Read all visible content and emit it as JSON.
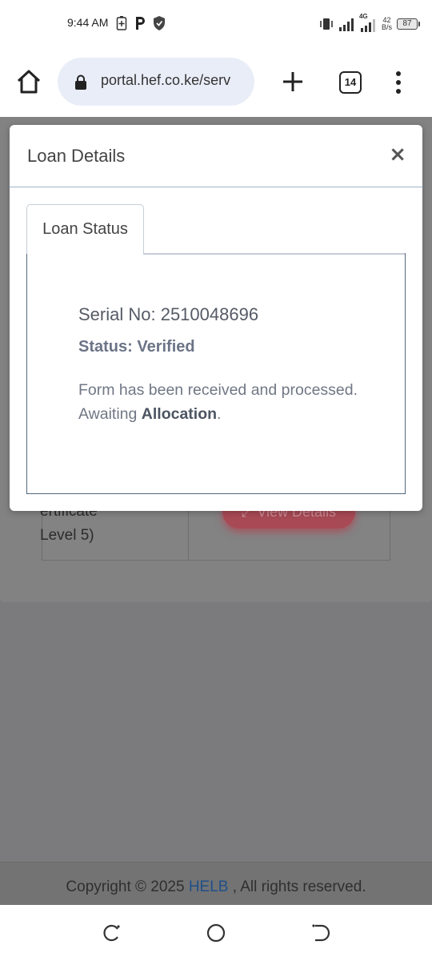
{
  "status_bar": {
    "time": "9:44 AM",
    "network_type": "4G",
    "net_speed_value": "42",
    "net_speed_unit": "B/s",
    "battery": "87"
  },
  "browser": {
    "url": "portal.hef.co.ke/serv",
    "tab_count": "14"
  },
  "background_page": {
    "row_text_line1": "ertificate",
    "row_text_line2": "Level 5)",
    "view_details_label": "View Details",
    "view_details_color": "#dc3545"
  },
  "modal": {
    "title": "Loan Details",
    "close_symbol": "×",
    "tab_label": "Loan Status",
    "serial": "Serial No: 2510048696",
    "status": "Status: Verified",
    "message_prefix": "Form has been received and processed. Awaiting ",
    "message_emphasis": "Allocation",
    "message_suffix": "."
  },
  "footer": {
    "copyright_prefix": "Copyright © 2025 ",
    "link_text": "HELB",
    "copyright_suffix": " , All rights reserved.",
    "link_color": "#1f4f88"
  }
}
